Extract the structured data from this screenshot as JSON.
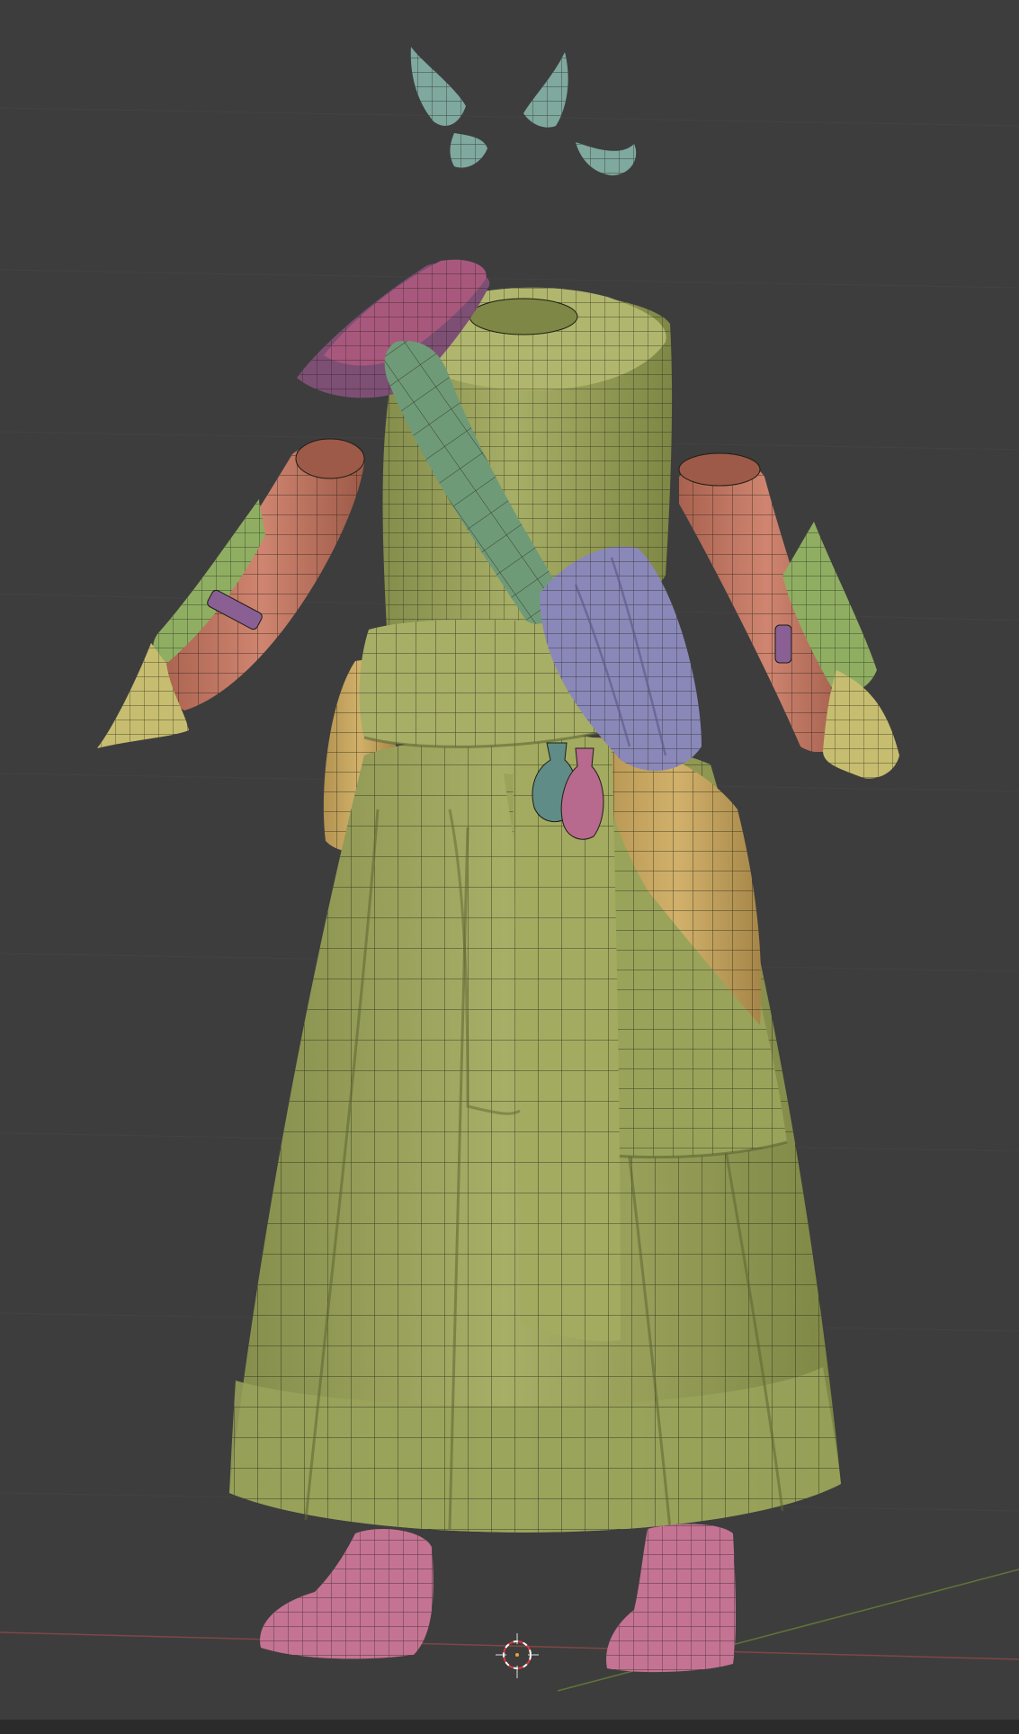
{
  "viewport": {
    "view": "3d-viewport",
    "shading": "solid-with-wireframe",
    "background_color": "#3d3d3d",
    "grid_color": "#454545"
  },
  "colors": {
    "dress": "#9aa35a",
    "dress_light": "#b5bb72",
    "dress_dark": "#6f7a3f",
    "sash": "#6f9a78",
    "sleeve": "#c77a63",
    "glove": "#8fae62",
    "cuff": "#c7bd70",
    "horn": "#7fa89e",
    "shoulder_cloth": "#a9587d",
    "shoulder_cloth_dark": "#7e4f75",
    "pouch": "#8a88b8",
    "holster": "#c8a75e",
    "potion_teal": "#5f8c86",
    "potion_pink": "#b8698e",
    "boots": "#c47393",
    "wire": "#1e1e14",
    "x_axis": "#9b4a4a",
    "y_axis": "#6f8a3a"
  },
  "icons": {
    "cursor": "3d-cursor-icon"
  },
  "scene": {
    "objects": [
      "horns",
      "shoulder-cloth",
      "dress",
      "sash",
      "pouch",
      "potions",
      "left-sleeve",
      "right-sleeve",
      "holster",
      "boots"
    ]
  }
}
